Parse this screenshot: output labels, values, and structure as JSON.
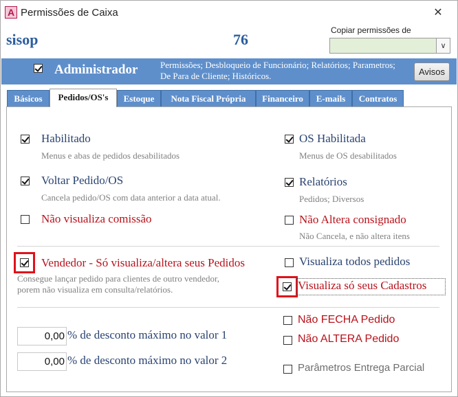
{
  "window": {
    "title": "Permissões de Caixa",
    "app_icon_letter": "A",
    "close_glyph": "✕"
  },
  "header": {
    "title": "sisop",
    "number": "76",
    "copy_label": "Copiar permissões de",
    "copy_value": "",
    "copy_arrow": "∨"
  },
  "banner": {
    "checked": true,
    "title": "Administrador",
    "description": "Permissões; Desbloqueio de Funcionário; Relatórios; Parametros; De Para de Cliente; Históricos.",
    "avisos_label": "Avisos"
  },
  "tabs": [
    "Básicos",
    "Pedidos/OS's",
    "Estoque",
    "Nota Fiscal Própria",
    "Financeiro",
    "E-mails",
    "Contratos"
  ],
  "active_tab": "Pedidos/OS's",
  "left": {
    "habilitado": {
      "label": "Habilitado",
      "desc": "Menus e abas de pedidos desabilitados",
      "checked": true
    },
    "voltar": {
      "label": "Voltar Pedido/OS",
      "desc": "Cancela pedido/OS com data anterior a data atual.",
      "checked": true
    },
    "nao_comissao": {
      "label": "Não visualiza comissão",
      "checked": false
    },
    "vendedor": {
      "label": "Vendedor - Só visualiza/altera seus Pedidos",
      "desc1": "Consegue lançar pedido para clientes de outro vendedor,",
      "desc2": "porem não visualiza em consulta/relatórios.",
      "checked": true
    },
    "desconto1": {
      "value": "0,00",
      "label": "% de desconto máximo no valor 1"
    },
    "desconto2": {
      "value": "0,00",
      "label": "% de desconto máximo no valor 2"
    }
  },
  "right": {
    "os_habilitada": {
      "label": "OS Habilitada",
      "desc": "Menus de OS desabilitados",
      "checked": true
    },
    "relatorios": {
      "label": "Relatórios",
      "desc": "Pedidos; Diversos",
      "checked": true
    },
    "nao_consignado": {
      "label": "Não Altera consignado",
      "desc": "Não Cancela, e não altera itens",
      "checked": false
    },
    "visualiza_todos": {
      "label": "Visualiza todos pedidos",
      "checked": false
    },
    "visualiza_seus": {
      "label": "Visualiza só seus Cadastros",
      "checked": true
    },
    "nao_fecha": {
      "label": "Não FECHA Pedido",
      "checked": false
    },
    "nao_altera": {
      "label": "Não ALTERA Pedido",
      "checked": false
    },
    "entrega_parcial": {
      "label": "Parâmetros Entrega Parcial",
      "checked": false
    }
  },
  "colors": {
    "accent_blue": "#5f8fcb",
    "label_blue": "#2a4370",
    "label_red": "#b8121b",
    "highlight_red": "#e0101a",
    "select_green": "#e3efd8"
  }
}
